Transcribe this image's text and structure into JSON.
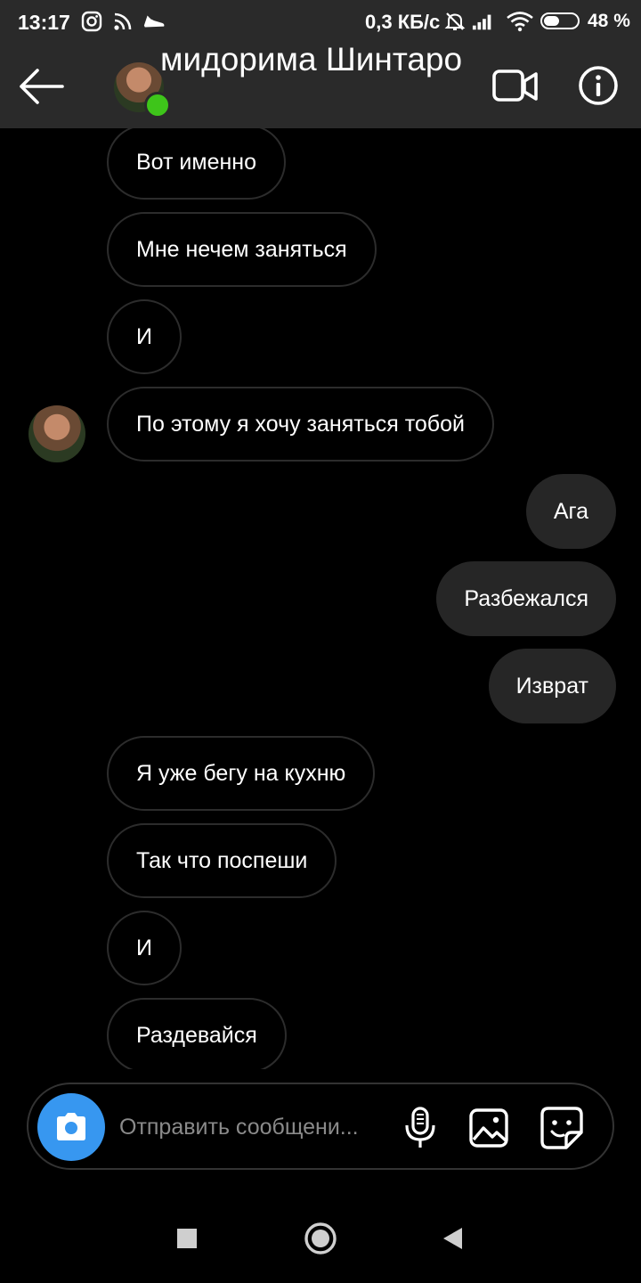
{
  "status_bar": {
    "time": "13:17",
    "network_speed": "0,3 КБ/с",
    "battery_percent": "48 %",
    "battery_level": 0.48,
    "icons": [
      "instagram-icon",
      "rss-icon",
      "sneaker-icon",
      "bell-off-icon",
      "signal-icon",
      "wifi-icon",
      "battery-icon"
    ]
  },
  "header": {
    "title": "мидорима Шинтаро",
    "online": true,
    "icons": [
      "back-arrow-icon",
      "video-call-icon",
      "info-icon"
    ]
  },
  "messages": [
    {
      "side": "in",
      "text": "Вот именно"
    },
    {
      "side": "in",
      "text": "Мне нечем заняться"
    },
    {
      "side": "in",
      "text": "И"
    },
    {
      "side": "in",
      "text": "По этому я хочу заняться тобой",
      "avatar": true
    },
    {
      "side": "out",
      "text": "Ага"
    },
    {
      "side": "out",
      "text": "Разбежался"
    },
    {
      "side": "out",
      "text": "Изврат"
    },
    {
      "side": "in",
      "text": "Я уже бегу на кухню"
    },
    {
      "side": "in",
      "text": "Так что поспеши"
    },
    {
      "side": "in",
      "text": "И"
    },
    {
      "side": "in",
      "text": "Раздевайся"
    }
  ],
  "composer": {
    "placeholder": "Отправить сообщени...",
    "value": "",
    "icons": [
      "camera-icon",
      "microphone-icon",
      "gallery-icon",
      "sticker-icon"
    ],
    "accent": "#3797f0"
  },
  "nav_bar": {
    "icons": [
      "recents-square-icon",
      "home-circle-icon",
      "back-triangle-icon"
    ]
  },
  "colors": {
    "background": "#000000",
    "header": "#2a2a2a",
    "outgoing_bubble": "#262626",
    "incoming_border": "#2c2c2c",
    "online_dot": "#3ec51a"
  }
}
